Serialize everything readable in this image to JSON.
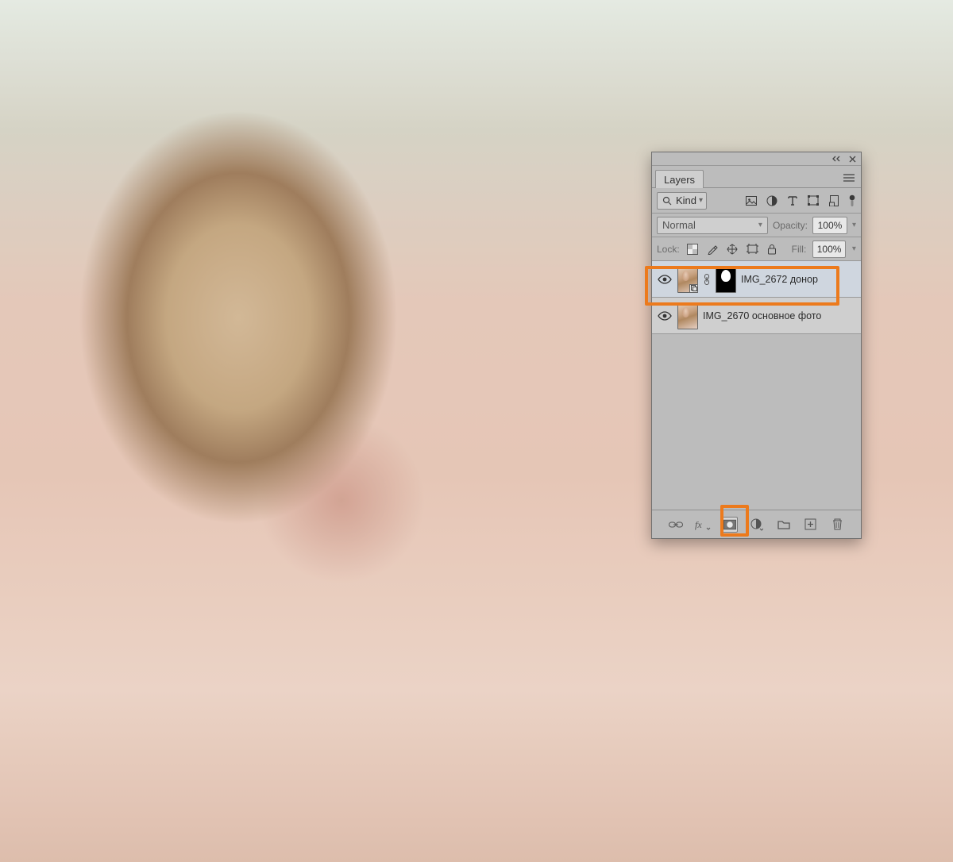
{
  "panel": {
    "tab_title": "Layers",
    "filter": {
      "kind_label": "Kind"
    },
    "blend": {
      "mode": "Normal",
      "opacity_label": "Opacity:",
      "opacity_value": "100%"
    },
    "lock": {
      "label": "Lock:",
      "fill_label": "Fill:",
      "fill_value": "100%"
    },
    "layers": [
      {
        "name": "IMG_2672 донор",
        "has_mask": true,
        "smart": true,
        "selected": true
      },
      {
        "name": "IMG_2670 основное фото",
        "has_mask": false,
        "smart": false,
        "selected": false
      }
    ]
  }
}
